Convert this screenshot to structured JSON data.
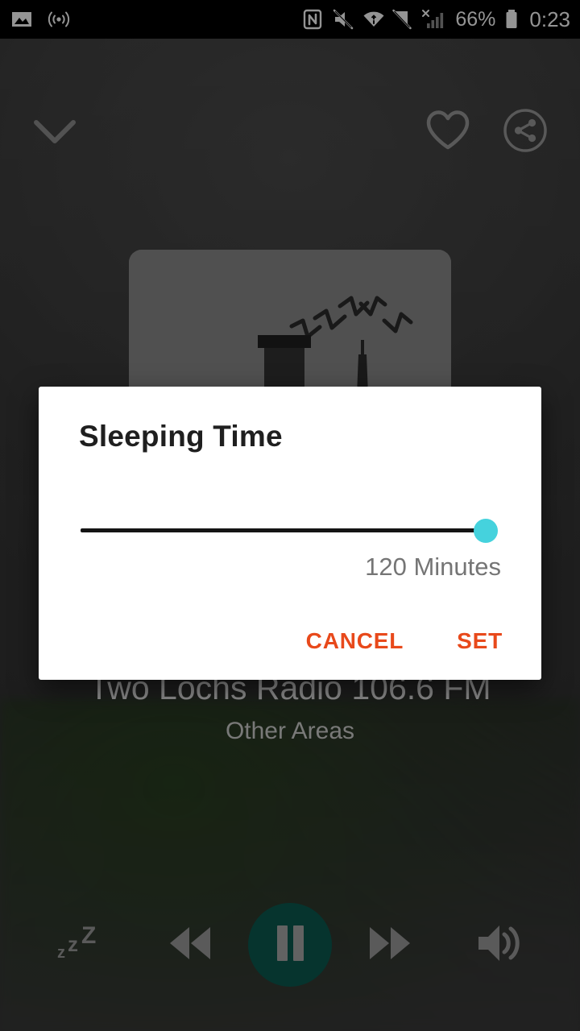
{
  "status_bar": {
    "left_icons": [
      {
        "name": "screenshot-image-icon",
        "label": "Screenshot"
      },
      {
        "name": "cast-broadcast-icon",
        "label": "Broadcast"
      }
    ],
    "right_icons": [
      {
        "name": "nfc-icon",
        "label": "NFC"
      },
      {
        "name": "volume-mute-icon",
        "label": "Silent"
      },
      {
        "name": "wifi-icon",
        "label": "Wi-Fi"
      },
      {
        "name": "sync-disabled-icon",
        "label": "Sync off"
      },
      {
        "name": "cellular-signal-no-service-icon",
        "label": "No SIM"
      }
    ],
    "battery_percent": "66%",
    "clock": "0:23"
  },
  "player": {
    "collapse_icon": "chevron-down-icon",
    "favorite_icon": "heart-outline-icon",
    "share_icon": "share-circle-icon",
    "album_art_alt": "radio-station-logo",
    "station_name": "Two Lochs Radio 106.6 FM",
    "station_region": "Other Areas",
    "controls": [
      {
        "name": "sleep-timer-button",
        "icon": "zzz-icon",
        "label": "Sleep timer"
      },
      {
        "name": "rewind-button",
        "icon": "rewind-icon",
        "label": "Rewind"
      },
      {
        "name": "pause-button",
        "icon": "pause-icon",
        "label": "Pause"
      },
      {
        "name": "fast-forward-button",
        "icon": "fast-forward-icon",
        "label": "Fast forward"
      },
      {
        "name": "volume-button",
        "icon": "volume-up-icon",
        "label": "Volume"
      }
    ],
    "play_button_color": "#0b5a50"
  },
  "dialog": {
    "title": "Sleeping Time",
    "slider": {
      "value_label": "120 Minutes",
      "value": 120,
      "min": 0,
      "max": 120,
      "percent": 100,
      "thumb_color": "#45d2dd",
      "track_color": "#141414"
    },
    "cancel_label": "CANCEL",
    "set_label": "SET",
    "action_color": "#e8491b"
  }
}
